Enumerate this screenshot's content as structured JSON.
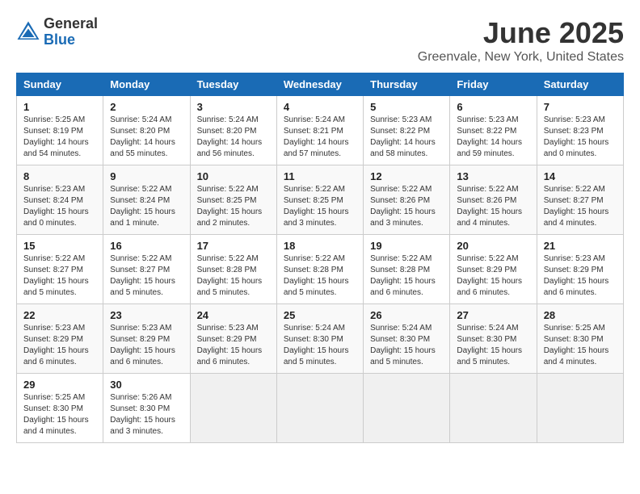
{
  "header": {
    "logo_general": "General",
    "logo_blue": "Blue",
    "month_title": "June 2025",
    "location": "Greenvale, New York, United States"
  },
  "calendar": {
    "days_of_week": [
      "Sunday",
      "Monday",
      "Tuesday",
      "Wednesday",
      "Thursday",
      "Friday",
      "Saturday"
    ],
    "weeks": [
      [
        {
          "day": "",
          "info": ""
        },
        {
          "day": "2",
          "info": "Sunrise: 5:24 AM\nSunset: 8:20 PM\nDaylight: 14 hours\nand 55 minutes."
        },
        {
          "day": "3",
          "info": "Sunrise: 5:24 AM\nSunset: 8:20 PM\nDaylight: 14 hours\nand 56 minutes."
        },
        {
          "day": "4",
          "info": "Sunrise: 5:24 AM\nSunset: 8:21 PM\nDaylight: 14 hours\nand 57 minutes."
        },
        {
          "day": "5",
          "info": "Sunrise: 5:23 AM\nSunset: 8:22 PM\nDaylight: 14 hours\nand 58 minutes."
        },
        {
          "day": "6",
          "info": "Sunrise: 5:23 AM\nSunset: 8:22 PM\nDaylight: 14 hours\nand 59 minutes."
        },
        {
          "day": "7",
          "info": "Sunrise: 5:23 AM\nSunset: 8:23 PM\nDaylight: 15 hours\nand 0 minutes."
        }
      ],
      [
        {
          "day": "1",
          "info": "Sunrise: 5:25 AM\nSunset: 8:19 PM\nDaylight: 14 hours\nand 54 minutes."
        },
        {
          "day": "8",
          "info": "Sunrise: 5:23 AM\nSunset: 8:24 PM\nDaylight: 15 hours\nand 0 minutes."
        },
        {
          "day": "9",
          "info": "Sunrise: 5:22 AM\nSunset: 8:24 PM\nDaylight: 15 hours\nand 1 minute."
        },
        {
          "day": "10",
          "info": "Sunrise: 5:22 AM\nSunset: 8:25 PM\nDaylight: 15 hours\nand 2 minutes."
        },
        {
          "day": "11",
          "info": "Sunrise: 5:22 AM\nSunset: 8:25 PM\nDaylight: 15 hours\nand 3 minutes."
        },
        {
          "day": "12",
          "info": "Sunrise: 5:22 AM\nSunset: 8:26 PM\nDaylight: 15 hours\nand 3 minutes."
        },
        {
          "day": "13",
          "info": "Sunrise: 5:22 AM\nSunset: 8:26 PM\nDaylight: 15 hours\nand 4 minutes."
        },
        {
          "day": "14",
          "info": "Sunrise: 5:22 AM\nSunset: 8:27 PM\nDaylight: 15 hours\nand 4 minutes."
        }
      ],
      [
        {
          "day": "15",
          "info": "Sunrise: 5:22 AM\nSunset: 8:27 PM\nDaylight: 15 hours\nand 5 minutes."
        },
        {
          "day": "16",
          "info": "Sunrise: 5:22 AM\nSunset: 8:27 PM\nDaylight: 15 hours\nand 5 minutes."
        },
        {
          "day": "17",
          "info": "Sunrise: 5:22 AM\nSunset: 8:28 PM\nDaylight: 15 hours\nand 5 minutes."
        },
        {
          "day": "18",
          "info": "Sunrise: 5:22 AM\nSunset: 8:28 PM\nDaylight: 15 hours\nand 5 minutes."
        },
        {
          "day": "19",
          "info": "Sunrise: 5:22 AM\nSunset: 8:28 PM\nDaylight: 15 hours\nand 6 minutes."
        },
        {
          "day": "20",
          "info": "Sunrise: 5:22 AM\nSunset: 8:29 PM\nDaylight: 15 hours\nand 6 minutes."
        },
        {
          "day": "21",
          "info": "Sunrise: 5:23 AM\nSunset: 8:29 PM\nDaylight: 15 hours\nand 6 minutes."
        }
      ],
      [
        {
          "day": "22",
          "info": "Sunrise: 5:23 AM\nSunset: 8:29 PM\nDaylight: 15 hours\nand 6 minutes."
        },
        {
          "day": "23",
          "info": "Sunrise: 5:23 AM\nSunset: 8:29 PM\nDaylight: 15 hours\nand 6 minutes."
        },
        {
          "day": "24",
          "info": "Sunrise: 5:23 AM\nSunset: 8:29 PM\nDaylight: 15 hours\nand 6 minutes."
        },
        {
          "day": "25",
          "info": "Sunrise: 5:24 AM\nSunset: 8:30 PM\nDaylight: 15 hours\nand 5 minutes."
        },
        {
          "day": "26",
          "info": "Sunrise: 5:24 AM\nSunset: 8:30 PM\nDaylight: 15 hours\nand 5 minutes."
        },
        {
          "day": "27",
          "info": "Sunrise: 5:24 AM\nSunset: 8:30 PM\nDaylight: 15 hours\nand 5 minutes."
        },
        {
          "day": "28",
          "info": "Sunrise: 5:25 AM\nSunset: 8:30 PM\nDaylight: 15 hours\nand 4 minutes."
        }
      ],
      [
        {
          "day": "29",
          "info": "Sunrise: 5:25 AM\nSunset: 8:30 PM\nDaylight: 15 hours\nand 4 minutes."
        },
        {
          "day": "30",
          "info": "Sunrise: 5:26 AM\nSunset: 8:30 PM\nDaylight: 15 hours\nand 3 minutes."
        },
        {
          "day": "",
          "info": ""
        },
        {
          "day": "",
          "info": ""
        },
        {
          "day": "",
          "info": ""
        },
        {
          "day": "",
          "info": ""
        },
        {
          "day": "",
          "info": ""
        }
      ]
    ]
  }
}
